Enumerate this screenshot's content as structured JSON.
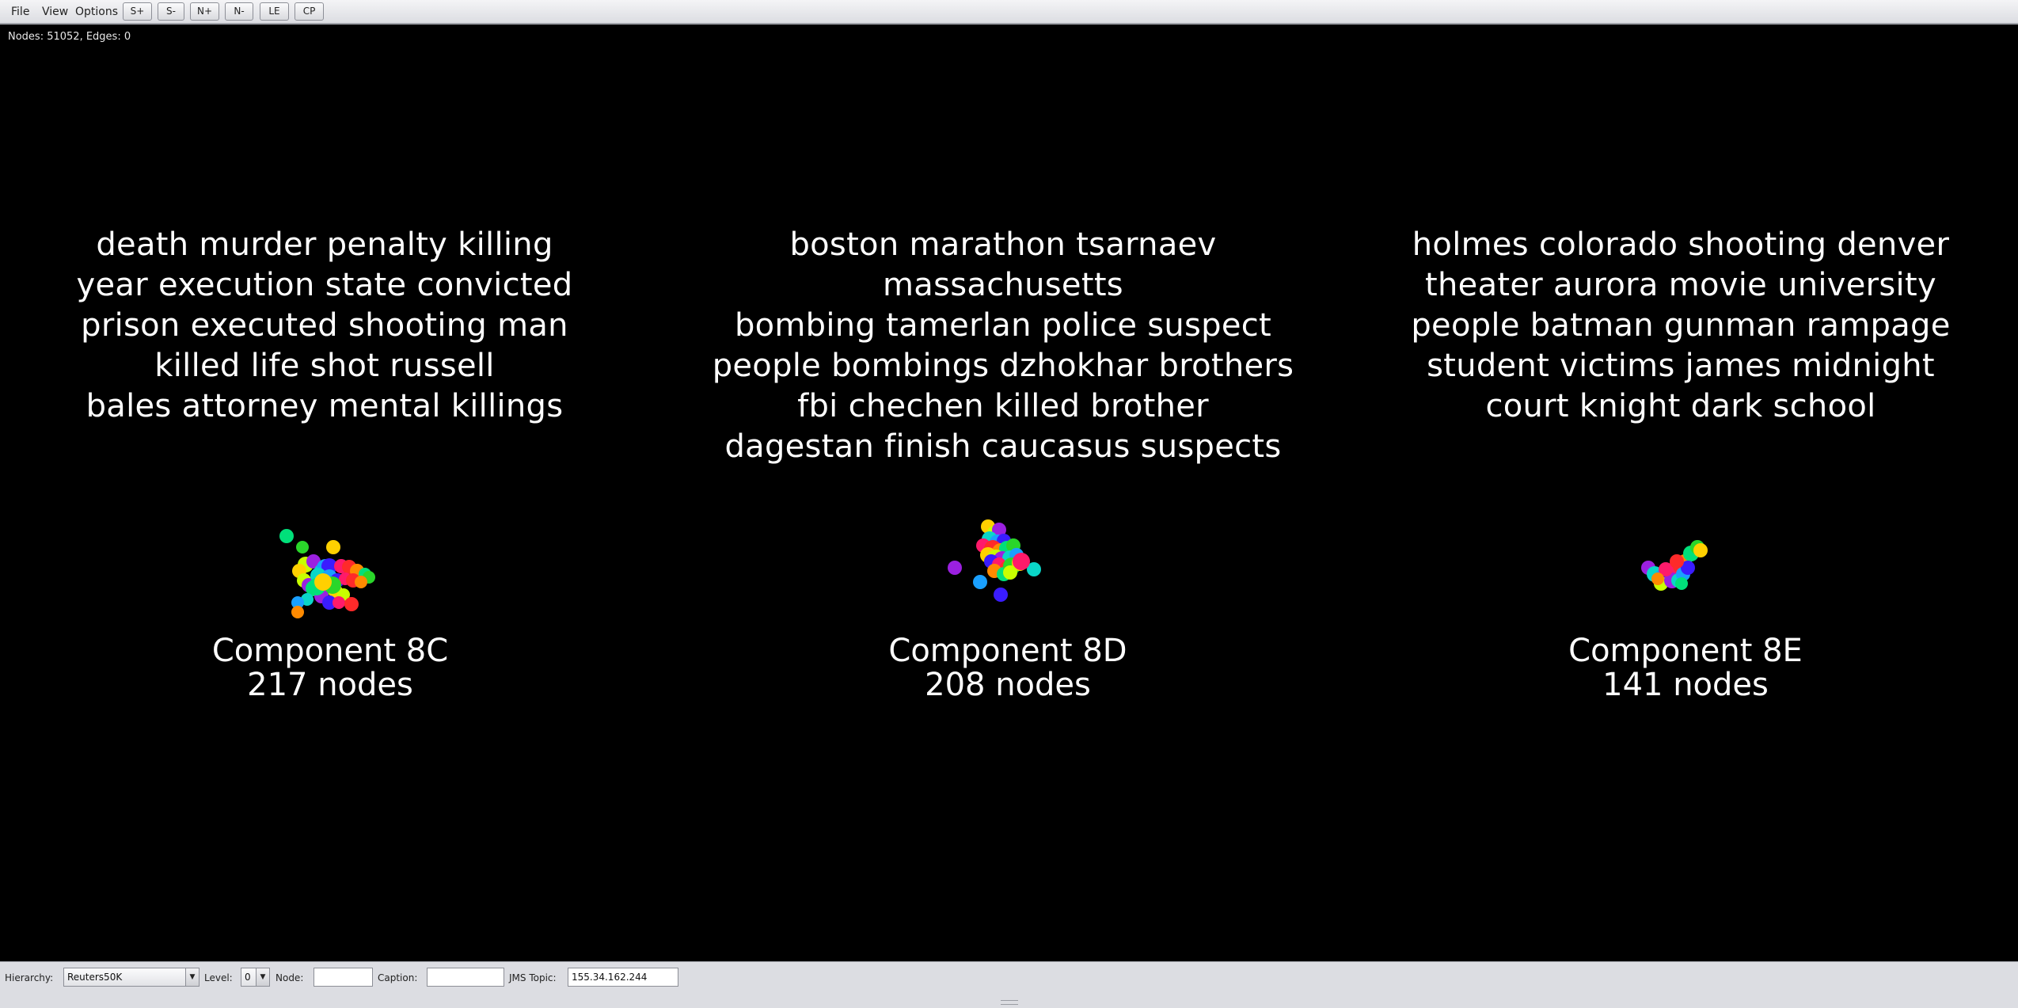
{
  "menu": {
    "file": "File",
    "view": "View",
    "options": "Options"
  },
  "toolbar": [
    "S+",
    "S-",
    "N+",
    "N-",
    "LE",
    "CP"
  ],
  "canvas": {
    "stats": "Nodes: 51052, Edges: 0",
    "components": [
      {
        "terms": [
          "death murder penalty killing",
          "year execution state convicted",
          "prison executed shooting man",
          "killed life shot russell",
          "bales attorney mental killings"
        ],
        "name": "Component 8C",
        "nodes": "217 nodes"
      },
      {
        "terms": [
          "boston marathon tsarnaev massachusetts",
          "bombing tamerlan police suspect",
          "people bombings dzhokhar brothers",
          "fbi chechen killed brother",
          "dagestan finish caucasus suspects"
        ],
        "name": "Component 8D",
        "nodes": "208 nodes"
      },
      {
        "terms": [
          "holmes colorado shooting denver",
          "theater aurora movie university",
          "people batman gunman rampage",
          "student victims james midnight",
          "court knight dark school"
        ],
        "name": "Component 8E",
        "nodes": "141 nodes"
      }
    ],
    "node_colors": [
      "#00e07a",
      "#ff1a6a",
      "#0ad6c8",
      "#ffd000",
      "#ff8a00",
      "#3a1cff",
      "#9b20e0",
      "#2ad62a",
      "#ff2a2a",
      "#1aa0ff",
      "#c8ff00"
    ]
  },
  "status": {
    "hierarchy_label": "Hierarchy:",
    "hierarchy_value": "Reuters50K",
    "level_label": "Level:",
    "level_value": "0",
    "node_label": "Node:",
    "node_value": "",
    "caption_label": "Caption:",
    "caption_value": "",
    "jms_label": "JMS Topic:",
    "jms_value": "155.34.162.244"
  }
}
